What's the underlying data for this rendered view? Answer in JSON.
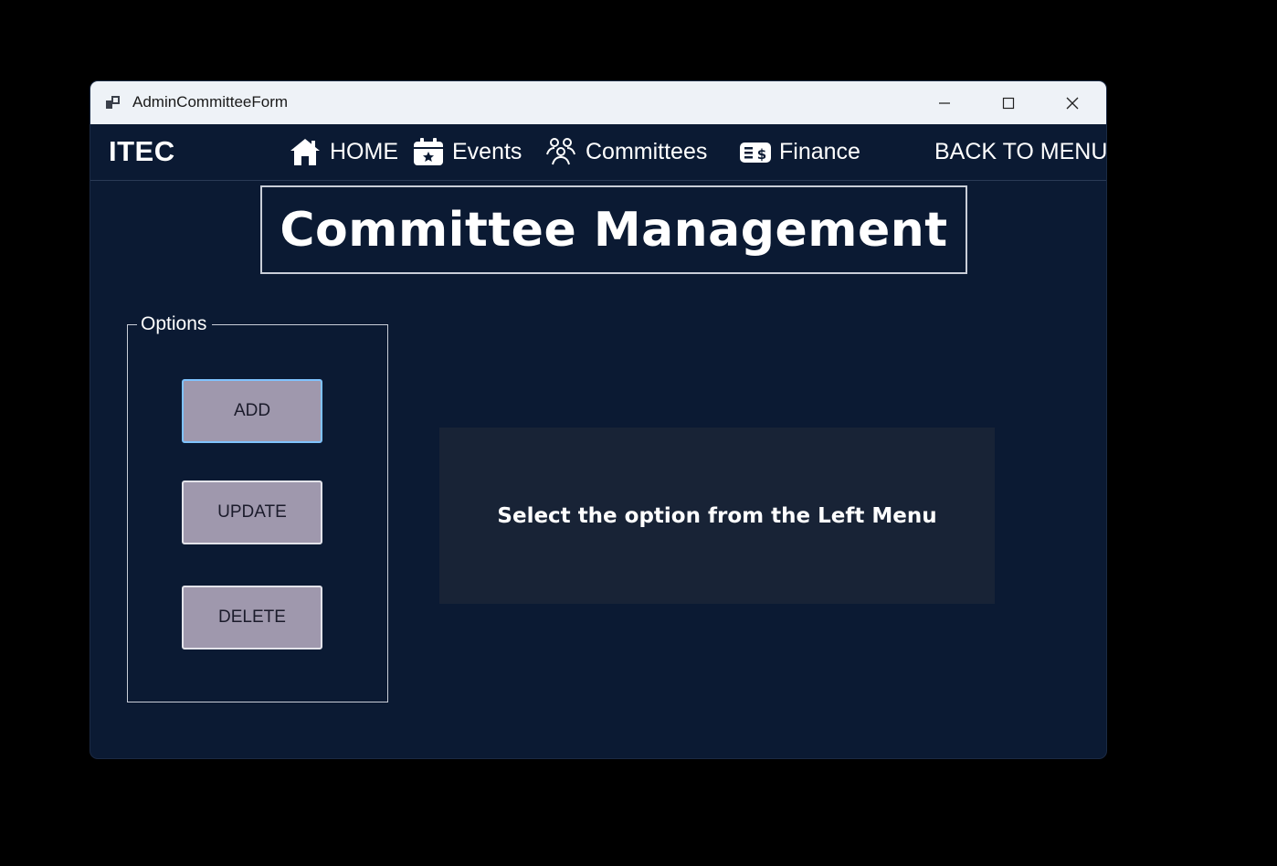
{
  "window": {
    "title": "AdminCommitteeForm"
  },
  "navbar": {
    "brand": "ITEC",
    "items": [
      {
        "label": "HOME",
        "icon": "home-icon"
      },
      {
        "label": "Events",
        "icon": "calendar-icon"
      },
      {
        "label": "Committees",
        "icon": "people-icon"
      },
      {
        "label": "Finance",
        "icon": "finance-icon"
      }
    ],
    "back_label": "BACK TO MENU"
  },
  "page": {
    "title": "Committee Management"
  },
  "options": {
    "legend": "Options",
    "buttons": [
      {
        "label": "ADD"
      },
      {
        "label": "UPDATE"
      },
      {
        "label": "DELETE"
      }
    ]
  },
  "content": {
    "message": "Select the option from the Left Menu"
  },
  "colors": {
    "background": "#0b1a33",
    "panel": "#182336",
    "button": "#9f98ad",
    "focus_border": "#7fc3ff"
  }
}
